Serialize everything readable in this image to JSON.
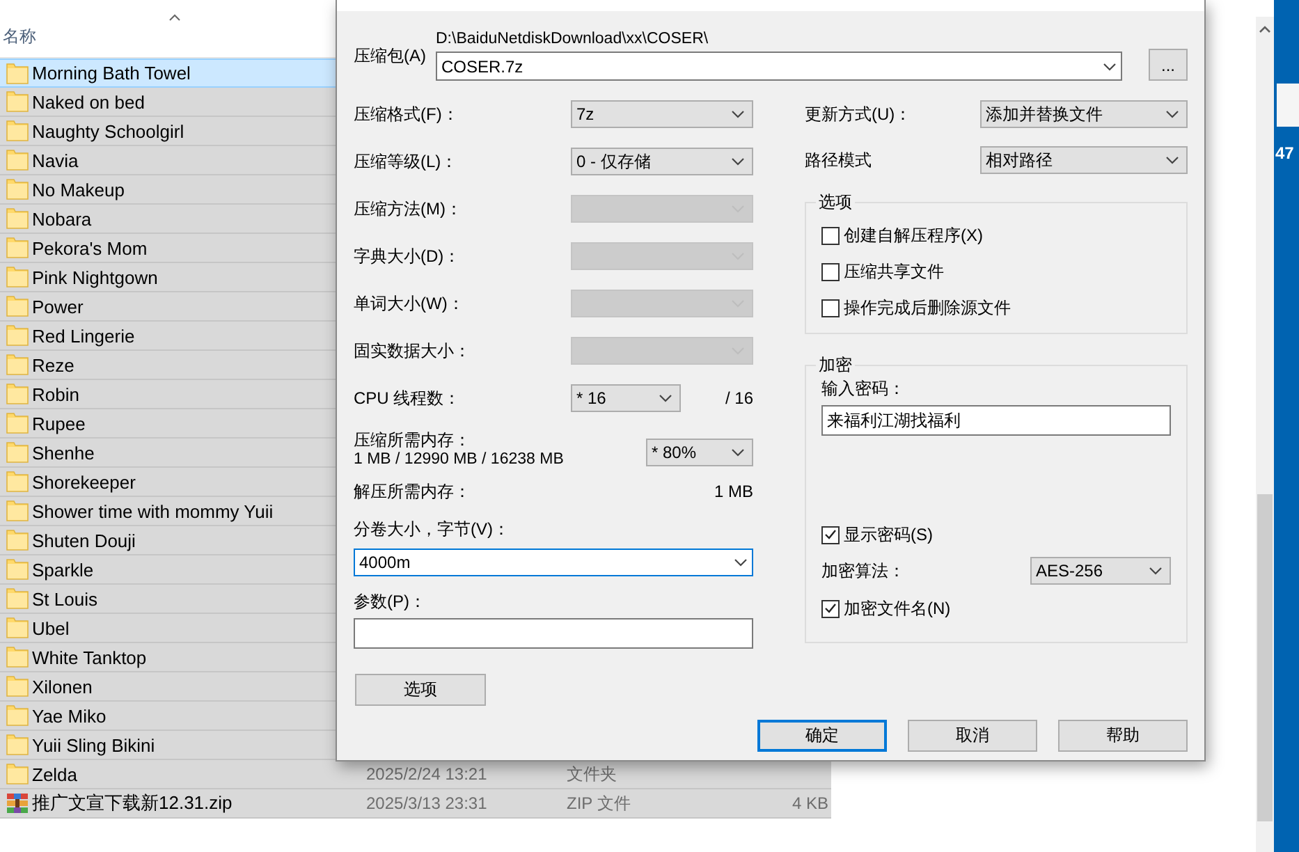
{
  "explorer": {
    "column_header": "名称",
    "rows": [
      {
        "name": "Morning Bath Towel",
        "kind": "folder",
        "selected": true
      },
      {
        "name": "Naked on bed",
        "kind": "folder",
        "selected": false
      },
      {
        "name": "Naughty Schoolgirl",
        "kind": "folder",
        "selected": false
      },
      {
        "name": "Navia",
        "kind": "folder",
        "selected": false
      },
      {
        "name": "No Makeup",
        "kind": "folder",
        "selected": false
      },
      {
        "name": "Nobara",
        "kind": "folder",
        "selected": false
      },
      {
        "name": "Pekora's Mom",
        "kind": "folder",
        "selected": false
      },
      {
        "name": "Pink Nightgown",
        "kind": "folder",
        "selected": false
      },
      {
        "name": "Power",
        "kind": "folder",
        "selected": false
      },
      {
        "name": "Red Lingerie",
        "kind": "folder",
        "selected": false
      },
      {
        "name": "Reze",
        "kind": "folder",
        "selected": false
      },
      {
        "name": "Robin",
        "kind": "folder",
        "selected": false
      },
      {
        "name": "Rupee",
        "kind": "folder",
        "selected": false
      },
      {
        "name": "Shenhe",
        "kind": "folder",
        "selected": false
      },
      {
        "name": "Shorekeeper",
        "kind": "folder",
        "selected": false
      },
      {
        "name": "Shower time with mommy Yuii",
        "kind": "folder",
        "selected": false
      },
      {
        "name": "Shuten Douji",
        "kind": "folder",
        "selected": false
      },
      {
        "name": "Sparkle",
        "kind": "folder",
        "selected": false
      },
      {
        "name": "St Louis",
        "kind": "folder",
        "selected": false
      },
      {
        "name": "Ubel",
        "kind": "folder",
        "selected": false
      },
      {
        "name": "White Tanktop",
        "kind": "folder",
        "selected": false
      },
      {
        "name": "Xilonen",
        "kind": "folder",
        "selected": false
      },
      {
        "name": "Yae Miko",
        "kind": "folder",
        "selected": false
      },
      {
        "name": "Yuii Sling Bikini",
        "kind": "folder",
        "selected": false
      },
      {
        "name": "Zelda",
        "kind": "folder",
        "selected": false,
        "date": "2025/2/24 13:21",
        "type": "文件夹"
      },
      {
        "name": "推广文宣下载新12.31.zip",
        "kind": "zip",
        "selected": false,
        "date": "2025/3/13 23:31",
        "type": "ZIP 文件",
        "size": "4 KB"
      }
    ]
  },
  "dialog": {
    "archive_label": "压缩包(A)",
    "archive_path": "D:\\BaiduNetdiskDownload\\xx\\COSER\\",
    "archive_name": "COSER.7z",
    "browse_button": "...",
    "left_fields": [
      {
        "label": "压缩格式(F)：",
        "value": "7z",
        "disabled": false
      },
      {
        "label": "压缩等级(L)：",
        "value": "0 - 仅存储",
        "disabled": false
      },
      {
        "label": "压缩方法(M)：",
        "disabled": true
      },
      {
        "label": "字典大小(D)：",
        "disabled": true
      },
      {
        "label": "单词大小(W)：",
        "disabled": true
      },
      {
        "label": "固实数据大小：",
        "disabled": true
      }
    ],
    "cpu_threads": {
      "label": "CPU 线程数：",
      "value": "* 16",
      "total": "/ 16"
    },
    "memory": {
      "label": "压缩所需内存：",
      "detail": "1 MB / 12990 MB / 16238 MB",
      "value": "* 80%"
    },
    "decompress_memory": {
      "label": "解压所需内存：",
      "value": "1 MB"
    },
    "volume": {
      "label": "分卷大小，字节(V)：",
      "value": "4000m"
    },
    "parameters": {
      "label": "参数(P)："
    },
    "options_button": "选项",
    "update_mode": {
      "label": "更新方式(U)：",
      "value": "添加并替换文件"
    },
    "path_mode": {
      "label": "路径模式",
      "value": "相对路径"
    },
    "options": {
      "title": "选项",
      "checkboxes": [
        {
          "label": "创建自解压程序(X)",
          "checked": false
        },
        {
          "label": "压缩共享文件",
          "checked": false
        },
        {
          "label": "操作完成后删除源文件",
          "checked": false
        }
      ]
    },
    "encryption": {
      "title": "加密",
      "password_label": "输入密码：",
      "password": "来福利江湖找福利",
      "show_password": {
        "label": "显示密码(S)",
        "checked": true
      },
      "method_label": "加密算法：",
      "method": "AES-256",
      "encrypt_names": {
        "label": "加密文件名(N)",
        "checked": true
      }
    },
    "buttons": [
      {
        "label": "确定",
        "default": true
      },
      {
        "label": "取消",
        "default": false
      },
      {
        "label": "帮助",
        "default": false
      }
    ]
  },
  "desktop": {
    "label": "47"
  }
}
